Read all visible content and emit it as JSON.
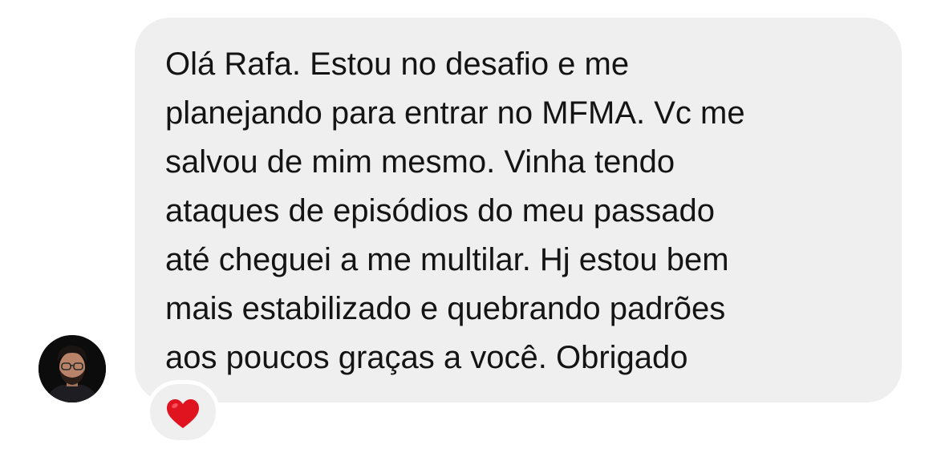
{
  "message": {
    "lines": [
      "Olá Rafa. Estou no desafio e me",
      "planejando para entrar no MFMA. Vc me",
      "salvou de mim mesmo. Vinha tendo",
      "ataques de episódios do meu passado",
      "até cheguei a me multilar. Hj estou bem",
      "mais estabilizado e quebrando padrões",
      "aos poucos graças a você. Obrigado"
    ],
    "bubble_color": "#efefef",
    "text_color": "#141414"
  },
  "reaction": {
    "icon": "heart-icon",
    "color": "#e0141e"
  },
  "sender": {
    "avatar": "avatar"
  }
}
